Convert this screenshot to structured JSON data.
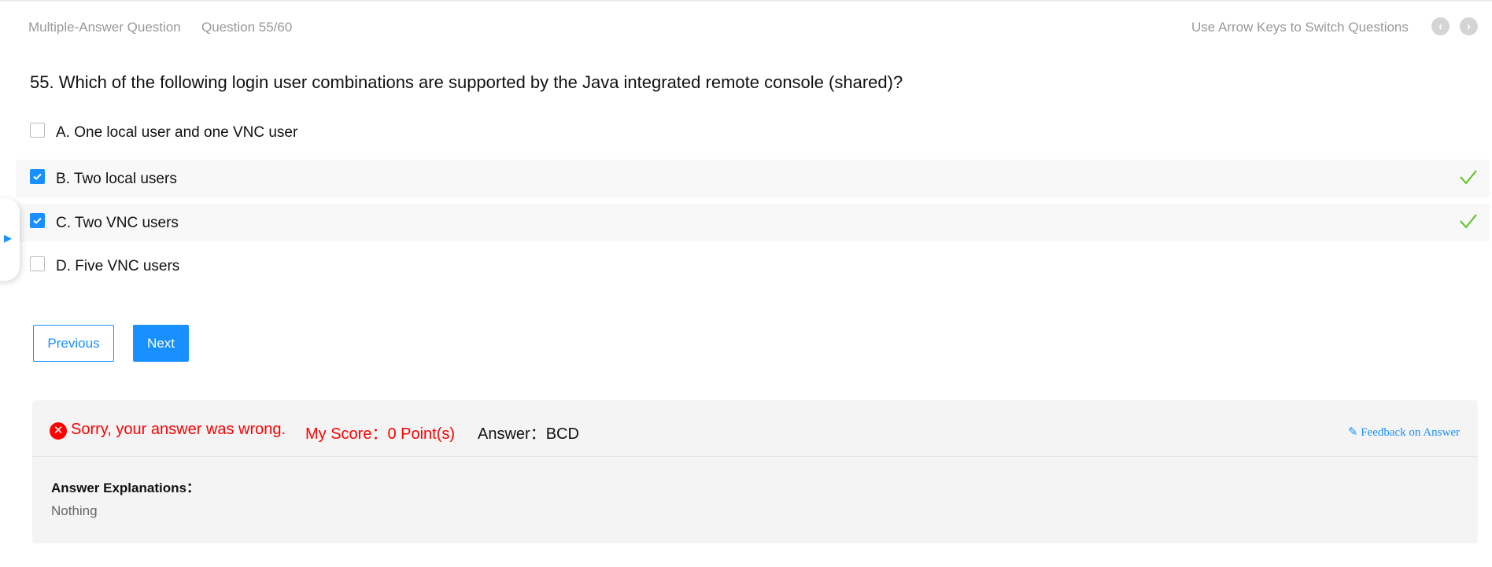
{
  "header": {
    "type": "Multiple-Answer Question",
    "progress": "Question 55/60",
    "hint": "Use Arrow Keys to Switch Questions"
  },
  "question": "55. Which of the following login user combinations are supported by the Java integrated remote console (shared)?",
  "options": [
    {
      "label": "A. One local user and one VNC user",
      "checked": false,
      "correct": false
    },
    {
      "label": "B. Two local users",
      "checked": true,
      "correct": true
    },
    {
      "label": "C. Two VNC users",
      "checked": true,
      "correct": true
    },
    {
      "label": "D. Five VNC users",
      "checked": false,
      "correct": false
    }
  ],
  "buttons": {
    "previous": "Previous",
    "next": "Next"
  },
  "result": {
    "status": "Sorry, your answer was wrong.",
    "score": "My Score：0 Point(s)",
    "answer": "Answer：BCD",
    "feedback_link": "Feedback on Answer",
    "explanation_title": "Answer Explanations：",
    "explanation": "Nothing"
  },
  "colors": {
    "accent": "#1890ff",
    "error": "#ff0000",
    "success": "#52c41a"
  }
}
